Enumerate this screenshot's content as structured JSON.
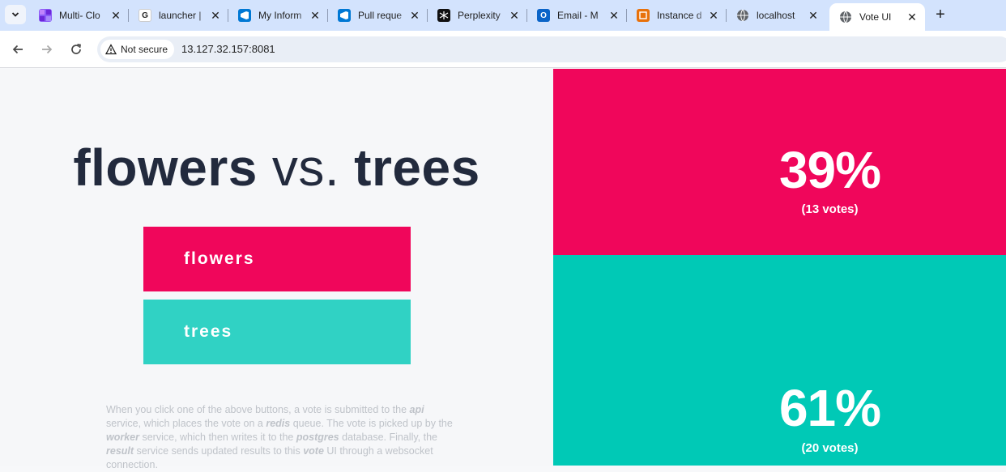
{
  "browser": {
    "tabs": [
      {
        "title": "Multi- Clo",
        "icon": "multi-cloud-icon",
        "color": "#8b5cf6"
      },
      {
        "title": "launcher |",
        "icon": "google-icon",
        "color": "#f2f2f2"
      },
      {
        "title": "My Inform",
        "icon": "azure-devops-icon",
        "color": "#0078d4"
      },
      {
        "title": "Pull reque",
        "icon": "azure-devops-icon",
        "color": "#0078d4"
      },
      {
        "title": "Perplexity",
        "icon": "perplexity-icon",
        "color": "#111111"
      },
      {
        "title": "Email - M",
        "icon": "outlook-icon",
        "color": "#0a64c8"
      },
      {
        "title": "Instance d",
        "icon": "instance-icon",
        "color": "#e8710a"
      },
      {
        "title": "localhost",
        "icon": "globe-icon",
        "color": "#5f6368"
      },
      {
        "title": "Vote UI",
        "icon": "globe-icon",
        "color": "#5f6368",
        "active": true
      }
    ],
    "security_label": "Not secure",
    "url": "13.127.32.157:8081"
  },
  "vote": {
    "option_a": "flowers",
    "vs": "vs.",
    "option_b": "trees",
    "button_a": "flowers",
    "button_b": "trees",
    "tip_parts": [
      "When you click one of the above buttons, a vote is submitted to the ",
      "api",
      " service, which places the vote on a ",
      "redis",
      " queue. The vote is picked up by the ",
      "worker",
      " service, which then writes it to the ",
      "postgres",
      " database. Finally, the ",
      "result",
      " service sends updated results to this ",
      "vote",
      " UI through a websocket connection."
    ]
  },
  "results": {
    "a_percent": "39%",
    "a_votes": "(13 votes)",
    "b_percent": "61%",
    "b_votes": "(20 votes)"
  },
  "colors": {
    "option_a": "#f0065b",
    "option_b_button": "#30d2c4",
    "option_b_result": "#00c9b6",
    "headline": "#222a3d"
  }
}
